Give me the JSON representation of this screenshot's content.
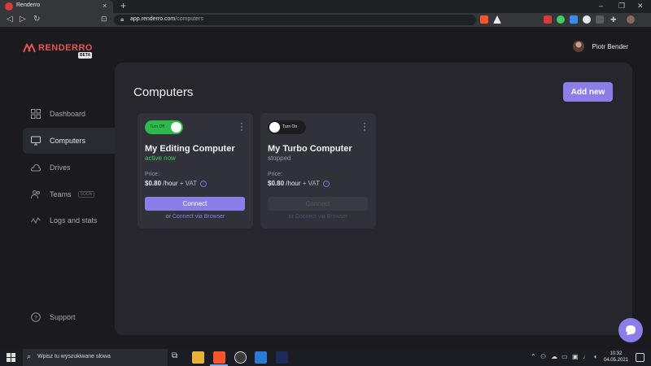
{
  "browser": {
    "tab_title": "Renderro",
    "tab_close": "×",
    "new_tab": "+",
    "url_host": "app.renderro.com",
    "url_path": "/computers",
    "nav": {
      "back": "◁",
      "forward": "▷",
      "reload": "↻",
      "bookmark": "⊡"
    },
    "window_controls": {
      "minimize": "–",
      "maximize": "❐",
      "close": "✕",
      "menu": "⌄"
    }
  },
  "app": {
    "logo_text": "RENDERRO",
    "beta_badge": "BETA",
    "user_name": "Piotr Bender",
    "brand_color": "#e85454",
    "accent_color": "#8b7ee8"
  },
  "sidebar": {
    "items": [
      {
        "label": "Dashboard",
        "icon": "dashboard-icon"
      },
      {
        "label": "Computers",
        "icon": "monitor-icon",
        "active": true
      },
      {
        "label": "Drives",
        "icon": "cloud-icon"
      },
      {
        "label": "Teams",
        "icon": "users-icon",
        "badge": "SOON"
      },
      {
        "label": "Logs and stats",
        "icon": "chart-line-icon"
      }
    ],
    "support_label": "Support"
  },
  "main": {
    "title": "Computers",
    "add_button": "Add new",
    "cards": [
      {
        "toggle_label": "Turn Off",
        "toggle_state": "on",
        "name": "My Editing Computer",
        "status": "active now",
        "price_label": "Price:",
        "price_value": "$0.80",
        "price_unit": "/hour",
        "price_vat": "+ VAT",
        "connect_label": "Connect",
        "connect_enabled": true,
        "or_text": "or",
        "browser_link": "Connect via Browser"
      },
      {
        "toggle_label": "Turn On",
        "toggle_state": "off",
        "name": "My Turbo Computer",
        "status": "stopped",
        "price_label": "Price:",
        "price_value": "$0.80",
        "price_unit": "/hour",
        "price_vat": "+ VAT",
        "connect_label": "Connect",
        "connect_enabled": false,
        "or_text": "or",
        "browser_link": "Connect via Browser"
      }
    ]
  },
  "taskbar": {
    "search_placeholder": "Wpisz tu wyszukiwane słowa",
    "time": "10:32",
    "date": "04.05.2021"
  }
}
